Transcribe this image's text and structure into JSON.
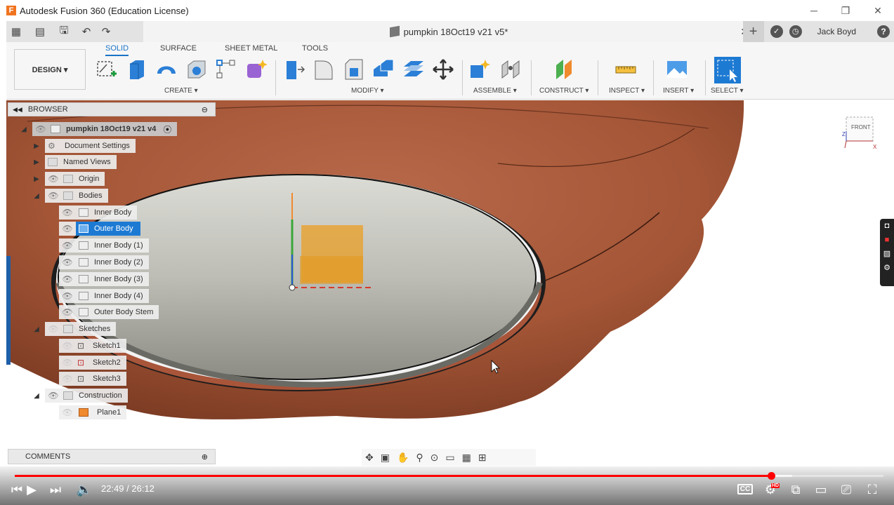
{
  "window": {
    "title": "Autodesk Fusion 360 (Education License)",
    "logo_letter": "F"
  },
  "doc_tab": {
    "title": "pumpkin 18Oct19 v21 v5*",
    "close": "✕"
  },
  "user": {
    "name": "Jack Boyd",
    "help": "?"
  },
  "toolbar": {
    "workspace": "DESIGN ▾",
    "tabs": [
      "SOLID",
      "SURFACE",
      "SHEET METAL",
      "TOOLS"
    ],
    "groups": {
      "create": "CREATE ▾",
      "modify": "MODIFY ▾",
      "assemble": "ASSEMBLE ▾",
      "construct": "CONSTRUCT ▾",
      "inspect": "INSPECT ▾",
      "insert": "INSERT ▾",
      "select": "SELECT ▾"
    }
  },
  "browser": {
    "title": "BROWSER",
    "root": "pumpkin 18Oct19 v21 v4",
    "items": [
      {
        "label": "Document Settings"
      },
      {
        "label": "Named Views"
      },
      {
        "label": "Origin"
      },
      {
        "label": "Bodies"
      },
      {
        "label": "Inner Body"
      },
      {
        "label": "Outer Body"
      },
      {
        "label": "Inner Body (1)"
      },
      {
        "label": "Inner Body (2)"
      },
      {
        "label": "Inner Body (3)"
      },
      {
        "label": "Inner Body (4)"
      },
      {
        "label": "Outer Body Stem"
      },
      {
        "label": "Sketches"
      },
      {
        "label": "Sketch1"
      },
      {
        "label": "Sketch2"
      },
      {
        "label": "Sketch3"
      },
      {
        "label": "Construction"
      },
      {
        "label": "Plane1"
      }
    ]
  },
  "viewcube": {
    "face": "FRONT",
    "axis_x": "X",
    "axis_z": "Z"
  },
  "comments": {
    "label": "COMMENTS"
  },
  "player": {
    "time": "22:49 / 26:12",
    "progress": 0.871,
    "buffered": 0.895,
    "hd": "HD",
    "cc": "CC"
  },
  "colors": {
    "accent": "#1d7ad3",
    "pumpkin": "#a85a3c",
    "progress": "#ff0000"
  }
}
